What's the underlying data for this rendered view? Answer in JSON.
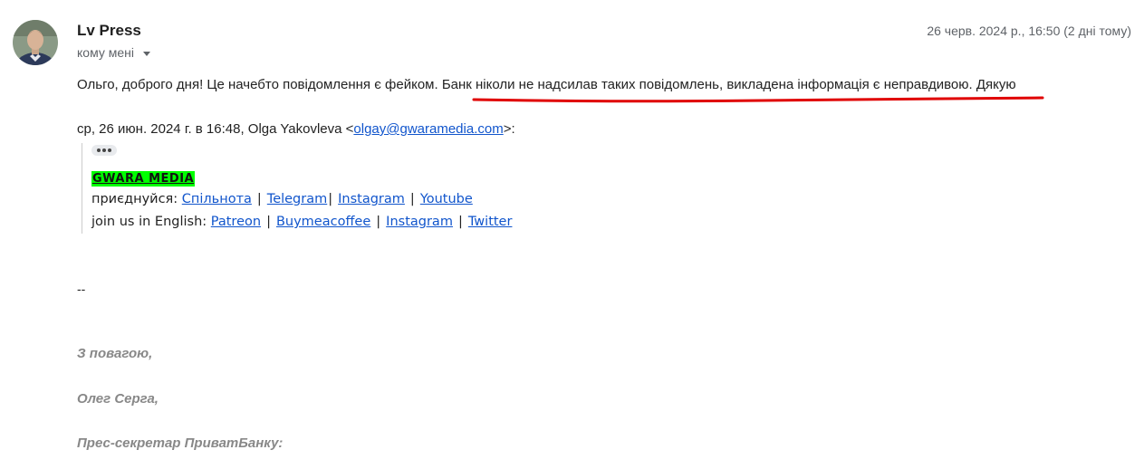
{
  "header": {
    "sender_name": "Lv Press",
    "recipient_label": "кому мені",
    "timestamp": "26 черв. 2024 р., 16:50 (2 дні тому)"
  },
  "message": {
    "text_before": "Ольго, доброго дня! Це начебто повідомлення є фейком. ",
    "text_highlighted": "Банк ніколи не надсилав таких повідомлень, викладена інформація є неправдивою.",
    "text_after": " Дякую",
    "underline_color": "#e00000"
  },
  "quote": {
    "header_prefix": "ср, 26 июн. 2024 г. в 16:48, Olga Yakovleva <",
    "email": "olgay@gwaramedia.com",
    "header_suffix": ">:",
    "brand": "GWARA MEDIA",
    "brand_bg": "#00ff00",
    "join_ua_label": "приєднуйся: ",
    "join_ua_links": [
      "Спільнота",
      "Telegram",
      "Instagram",
      "Youtube"
    ],
    "join_en_label": "join us in English: ",
    "join_en_links": [
      "Patreon",
      "Buymeacoffee",
      "Instagram",
      "Twitter"
    ]
  },
  "signature": {
    "separator": "--",
    "line1": "З повагою,",
    "line2": "Олег Серга,",
    "line3": "Прес-секретар ПриватБанку:"
  }
}
